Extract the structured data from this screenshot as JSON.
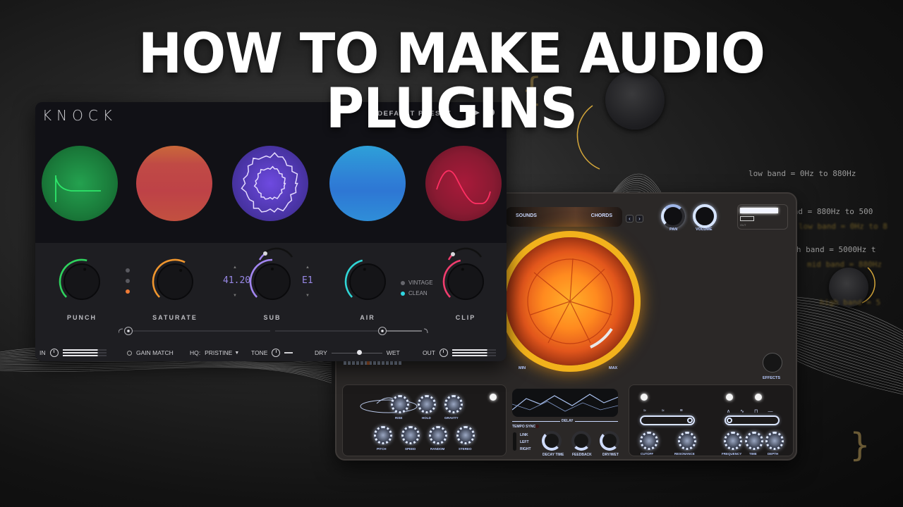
{
  "headline": "HOW TO MAKE AUDIO PLUGINS",
  "code_snippet": {
    "lines": [
      "low band = 0Hz to 880Hz",
      "mid band = 880Hz to 500",
      "high band = 5000Hz t"
    ],
    "blurred_lines": [
      "low band = 0Hz to 8",
      "mid band = 880Hz",
      "high band = 5"
    ]
  },
  "decor": {
    "brace_open": "{",
    "brace_close": "}"
  },
  "knock_plugin": {
    "logo": "KNOCK",
    "preset": {
      "name": "DEFAULT PRESET",
      "prev": "◀",
      "next": "▶",
      "add": "+"
    },
    "modules": [
      {
        "label": "PUNCH",
        "color": "#2fd35e"
      },
      {
        "label": "SATURATE",
        "color": "#f0962e"
      },
      {
        "label": "SUB",
        "color": "#a286f0"
      },
      {
        "label": "AIR",
        "color": "#30d6d6"
      },
      {
        "label": "CLIP",
        "color": "#f03d6e"
      }
    ],
    "saturate_modes_active_index": 2,
    "sub": {
      "frequency": "41.20",
      "note": "E1"
    },
    "air_modes": [
      {
        "label": "VINTAGE",
        "active": false
      },
      {
        "label": "CLEAN",
        "active": true
      }
    ],
    "bottom_bar": {
      "in_label": "IN",
      "gain_match": "GAIN MATCH",
      "hq_label": "HQ:",
      "hq_value": "PRISTINE",
      "hq_caret": "▼",
      "tone_label": "TONE",
      "dry_label": "DRY",
      "wet_label": "WET",
      "out_label": "OUT",
      "dry_wet_value": 0.55
    }
  },
  "lava_plugin": {
    "browser": {
      "left_label": "SOUNDS",
      "right_label": "CHORDS",
      "prev": "‹",
      "next": "›"
    },
    "knobs": {
      "pan": "PAN",
      "volume": "VOLUME"
    },
    "out_label": "OUT",
    "core": {
      "min_label": "MIN",
      "max_label": "MAX",
      "value": 0.85
    },
    "effects_label": "EFFECTS",
    "fx_left": {
      "knobs": [
        "RISE",
        "HOLD",
        "GRAVITY",
        "PITCH",
        "SPEED",
        "RANDOM",
        "STEREO"
      ]
    },
    "delay": {
      "title": "DELAY",
      "tempo_sync": "TEMPO SYNC",
      "routing": [
        "LINK",
        "LEFT",
        "RIGHT"
      ],
      "knobs": [
        "DECAY TIME",
        "FEEDBACK",
        "DRY/WET"
      ]
    },
    "filter": {
      "knobs": [
        "CUTOFF",
        "RESONANCE"
      ]
    },
    "lfo": {
      "knobs": [
        "FREQUENCY",
        "TIME",
        "DEPTH"
      ]
    }
  }
}
